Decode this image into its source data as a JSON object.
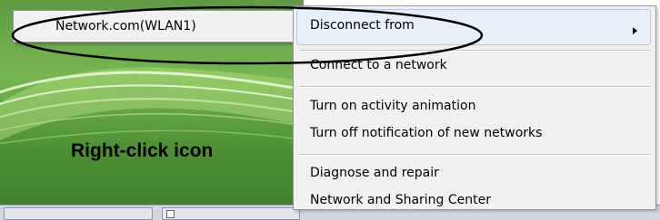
{
  "desktop": {
    "callout": "Right-click icon"
  },
  "submenu": {
    "items": [
      {
        "label": "Network.com(WLAN1)"
      }
    ]
  },
  "menu": {
    "items": [
      {
        "label": "Disconnect from"
      },
      {
        "label": "Connect to a network"
      },
      {
        "label": "Turn on activity animation"
      },
      {
        "label": "Turn off notification of new networks"
      },
      {
        "label": "Diagnose and repair"
      },
      {
        "label": "Network and Sharing Center"
      }
    ]
  },
  "colors": {
    "menu_bg": "#f1f1f1",
    "highlight": "#e8eff7",
    "highlight_border": "#aecbea",
    "desktop_green": "#77b653"
  },
  "icons": {
    "submenu_arrow": "chevron-right-icon",
    "annotation": "highlight-oval"
  }
}
